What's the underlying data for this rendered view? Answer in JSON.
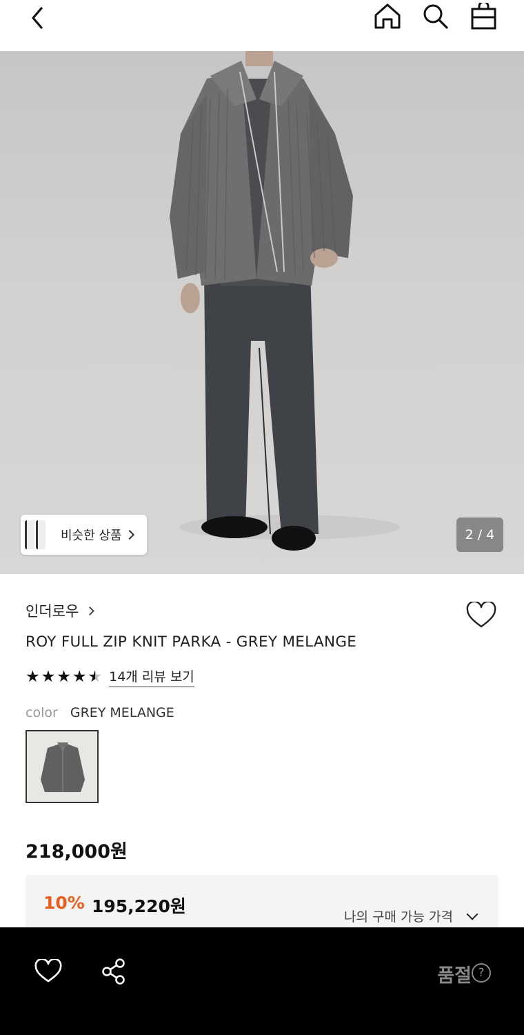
{
  "header": {
    "icons": [
      "chevron-left-icon",
      "home-icon",
      "search-icon",
      "shopping-bag-icon"
    ]
  },
  "gallery": {
    "similar_label": "비슷한 상품",
    "counter": "2 / 4"
  },
  "product": {
    "brand": "인더로우",
    "name": "ROY FULL ZIP KNIT PARKA - GREY MELANGE",
    "rating_stars": 4.5,
    "reviews_label": "14개 리뷰 보기",
    "color_key": "color",
    "color_value": "GREY MELANGE",
    "price": "218,000원",
    "discount_pct": "10%",
    "sale_price": "195,220원",
    "my_price_label": "나의 구매 가능 가격"
  },
  "bottom_bar": {
    "status": "품절",
    "help_glyph": "?"
  },
  "colors": {
    "accent_discount": "#e8601c",
    "bottom_bar_bg": "#000000",
    "soldout_text": "#888888"
  }
}
